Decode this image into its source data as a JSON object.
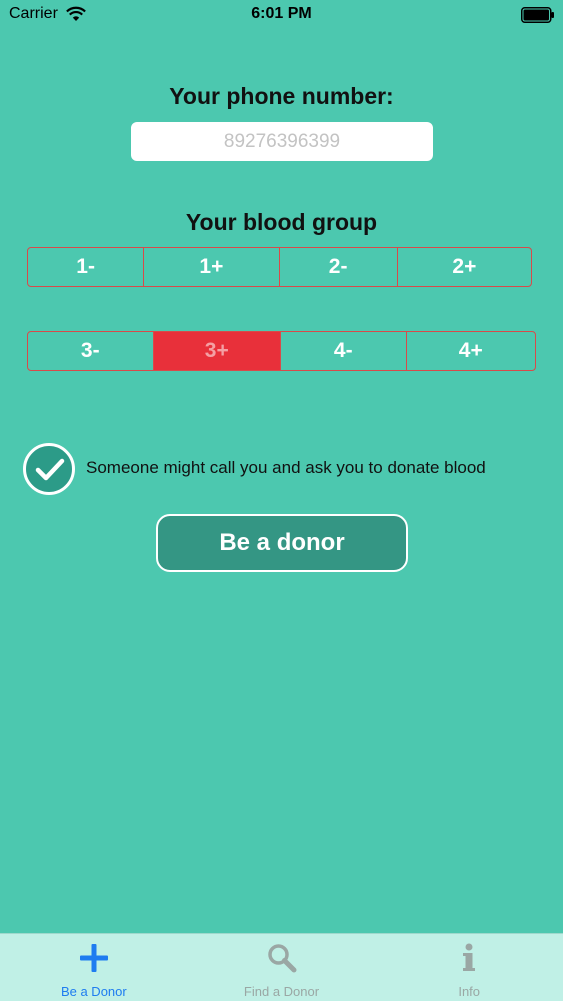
{
  "status_bar": {
    "carrier": "Carrier",
    "time": "6:01 PM"
  },
  "phone": {
    "label": "Your phone number:",
    "placeholder": "89276396399",
    "value": ""
  },
  "blood_group": {
    "label": "Your blood group",
    "row1": [
      {
        "label": "1-",
        "selected": false
      },
      {
        "label": "1+",
        "selected": false
      },
      {
        "label": "2-",
        "selected": false
      },
      {
        "label": "2+",
        "selected": false
      }
    ],
    "row2": [
      {
        "label": "3-",
        "selected": false
      },
      {
        "label": "3+",
        "selected": true
      },
      {
        "label": "4-",
        "selected": false
      },
      {
        "label": "4+",
        "selected": false
      }
    ]
  },
  "consent": {
    "checked": true,
    "text": "Someone might call you and ask you to donate blood"
  },
  "donor_button": {
    "label": "Be a donor"
  },
  "tab_bar": {
    "tabs": [
      {
        "label": "Be a Donor",
        "icon": "plus-icon",
        "active": true
      },
      {
        "label": "Find a Donor",
        "icon": "search-icon",
        "active": false
      },
      {
        "label": "Info",
        "icon": "info-icon",
        "active": false
      }
    ]
  },
  "colors": {
    "background": "#4CC8AF",
    "selected_segment": "#E8303A",
    "segment_border": "#D94A4A",
    "button_fill": "#349684",
    "tab_active": "#1E7CF0",
    "tab_inactive": "#9AA7A4",
    "tab_bar": "#C0F0E6"
  }
}
